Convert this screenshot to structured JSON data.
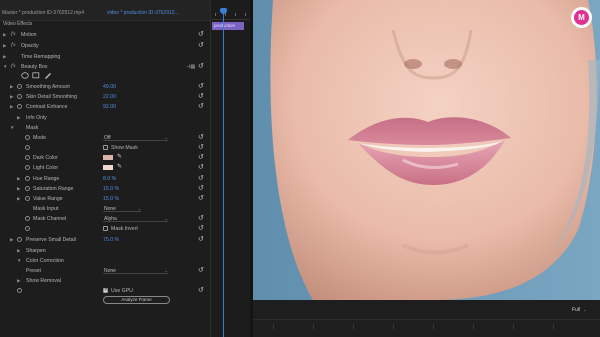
{
  "tabs": {
    "master": "Master * production ID-3762912.mp4",
    "clip": "video * production ID-3762912..."
  },
  "section_title": "Video Effects",
  "effects": {
    "motion": "Motion",
    "opacity": "Opacity",
    "time_remapping": "Time Remapping",
    "beauty_box": "Beauty Box"
  },
  "params": {
    "smoothing_amount": {
      "label": "Smoothing Amount",
      "value": "49.00"
    },
    "skin_detail_smoothing": {
      "label": "Skin Detail Smoothing",
      "value": "22.00"
    },
    "contrast_enhance": {
      "label": "Contrast Enhance",
      "value": "92.00"
    },
    "info_only": "Info Only",
    "mask": "Mask",
    "mode": {
      "label": "Mode",
      "value": "Off"
    },
    "show_mask": "Show Mask",
    "dark_color": "Dark Color",
    "light_color": "Light Color",
    "hue_range": {
      "label": "Hue Range",
      "value": "8.0 %"
    },
    "saturation_range": {
      "label": "Saturation Range",
      "value": "15.0 %"
    },
    "value_range": {
      "label": "Value Range",
      "value": "15.0 %"
    },
    "mask_input": {
      "label": "Mask Input",
      "value": "None"
    },
    "mask_channel": {
      "label": "Mask Channel",
      "value": "Alpha"
    },
    "mask_invert": "Mask Invert",
    "preserve_small_detail": {
      "label": "Preserve Small Detail",
      "value": "75.0 %"
    },
    "sharpen": "Sharpen",
    "color_correction": "Color Correction",
    "preset": {
      "label": "Preset",
      "value": "None"
    },
    "show_removal": "Show Removal",
    "use_gpu": "Use GPU",
    "analyze_frame": "Analyze Frame"
  },
  "timeline": {
    "clip_label": "production"
  },
  "monitor": {
    "fit": "Full"
  },
  "colors": {
    "accent_blue": "#4f8fe0",
    "dark_color_swatch": "#d9b3a4",
    "light_color_swatch": "#f1d8cc",
    "clip_purple": "#7b63c4"
  }
}
